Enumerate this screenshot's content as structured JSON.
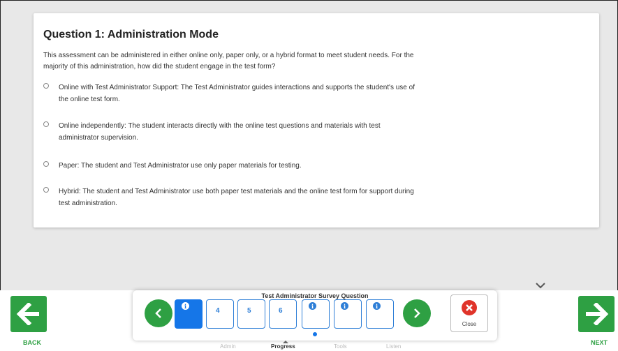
{
  "question": {
    "title": "Question 1: Administration Mode",
    "text": "This assessment can be administered in either online only, paper only, or a hybrid format to meet student needs. For the majority of this administration, how did the student engage in the test form?",
    "options": [
      {
        "text": "Online with Test Administrator Support: The Test Administrator guides interactions and supports the student's use of the online test form.",
        "selected": false
      },
      {
        "text": "Online independently: The student interacts directly with the online test questions and materials with test administrator supervision.",
        "selected": false
      },
      {
        "text": "Paper: The student and Test Administrator use only paper materials for testing.",
        "selected": false
      },
      {
        "text": "Hybrid: The student and Test Administrator use both paper test materials and the online test form for support during test administration.",
        "selected": false
      }
    ]
  },
  "nav": {
    "back_label": "BACK",
    "next_label": "NEXT"
  },
  "tray": {
    "title": "Test Administrator Survey Question",
    "items": [
      {
        "label": "",
        "info": true,
        "active": true
      },
      {
        "label": "4",
        "info": false,
        "active": false
      },
      {
        "label": "5",
        "info": false,
        "active": false
      },
      {
        "label": "6",
        "info": false,
        "active": false
      },
      {
        "label": "",
        "info": true,
        "active": false
      },
      {
        "label": "",
        "info": true,
        "active": false
      },
      {
        "label": "",
        "info": true,
        "active": false
      }
    ],
    "close_label": "Close"
  },
  "tabs": {
    "admin": "Admin",
    "progress": "Progress",
    "tools": "Tools",
    "listen": "Listen",
    "active": "progress"
  },
  "colors": {
    "nav_green": "#2ea043",
    "accent_blue": "#1576e8",
    "close_red": "#e0342a"
  },
  "icons": [
    "arrow-left-icon",
    "arrow-right-icon",
    "chevron-left-icon",
    "chevron-right-icon",
    "chevron-down-icon",
    "info-icon",
    "close-x-icon"
  ]
}
